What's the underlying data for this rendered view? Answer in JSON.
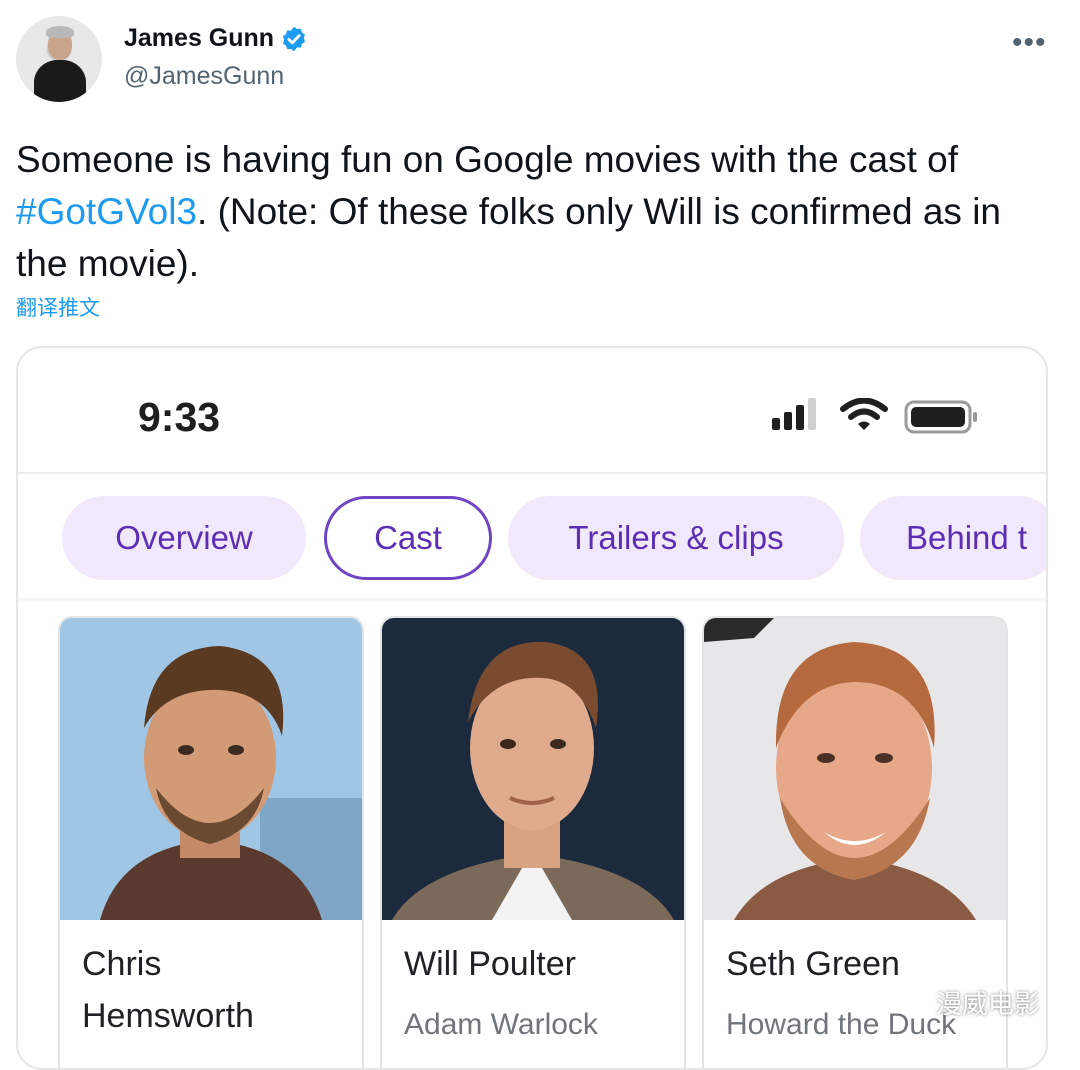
{
  "tweet": {
    "author": {
      "display_name": "James Gunn",
      "handle": "@JamesGunn",
      "verified": true
    },
    "more_icon": "more-horizontal-icon",
    "text_before": "Someone is having fun on Google movies with the cast of ",
    "hashtag": "#GotGVol3",
    "text_after": ". (Note: Of these folks only Will is confirmed as in the movie).",
    "translate_label": "翻译推文"
  },
  "screenshot": {
    "status_bar": {
      "time": "9:33",
      "icons": [
        "signal-icon",
        "wifi-icon",
        "battery-icon"
      ]
    },
    "tabs": [
      {
        "label": "Overview",
        "active": false
      },
      {
        "label": "Cast",
        "active": true
      },
      {
        "label": "Trailers & clips",
        "active": false
      },
      {
        "label": "Behind t",
        "active": false
      }
    ],
    "cast": [
      {
        "name": "Chris Hemsworth",
        "role": ""
      },
      {
        "name": "Will Poulter",
        "role": "Adam Warlock"
      },
      {
        "name": "Seth Green",
        "role": "Howard the Duck"
      }
    ]
  },
  "watermark": {
    "text": "漫威电影",
    "icon": "wechat-icon"
  },
  "colors": {
    "link": "#1d9bf0",
    "chip_bg": "#f1e9fb",
    "chip_text": "#5b2fb5",
    "chip_active_border": "#6f45c4"
  }
}
